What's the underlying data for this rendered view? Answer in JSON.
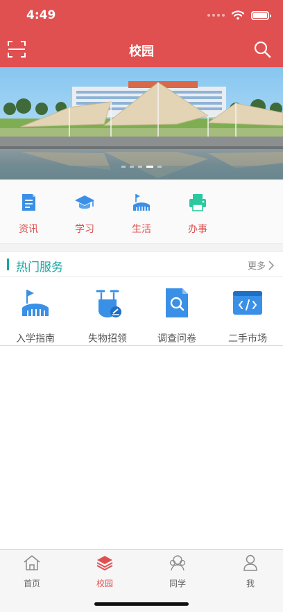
{
  "status_bar": {
    "time": "4:49"
  },
  "header": {
    "title": "校园",
    "scan_icon": "scan-icon",
    "search_icon": "search-icon"
  },
  "banner": {
    "slides": 5,
    "active_slide": 4
  },
  "quick_nav": [
    {
      "label": "资讯",
      "icon": "document-icon"
    },
    {
      "label": "学习",
      "icon": "graduation-cap-icon"
    },
    {
      "label": "生活",
      "icon": "stadium-flag-icon"
    },
    {
      "label": "办事",
      "icon": "printer-icon"
    }
  ],
  "hot_services": {
    "title": "热门服务",
    "more": "更多",
    "items": [
      {
        "label": "入学指南",
        "icon": "stadium-flag-icon"
      },
      {
        "label": "失物招领",
        "icon": "scooter-icon"
      },
      {
        "label": "调查问卷",
        "icon": "search-document-icon"
      },
      {
        "label": "二手市场",
        "icon": "code-browser-icon"
      }
    ]
  },
  "tabbar": {
    "active": "校园",
    "tabs": [
      {
        "label": "首页",
        "icon": "home-icon"
      },
      {
        "label": "校园",
        "icon": "layers-icon"
      },
      {
        "label": "同学",
        "icon": "classmates-icon"
      },
      {
        "label": "我",
        "icon": "user-icon"
      }
    ]
  },
  "colors": {
    "brand": "#e05050",
    "accent": "#1aa6a0",
    "icon_blue": "#3a8fe6",
    "icon_green": "#2cc8a0"
  }
}
